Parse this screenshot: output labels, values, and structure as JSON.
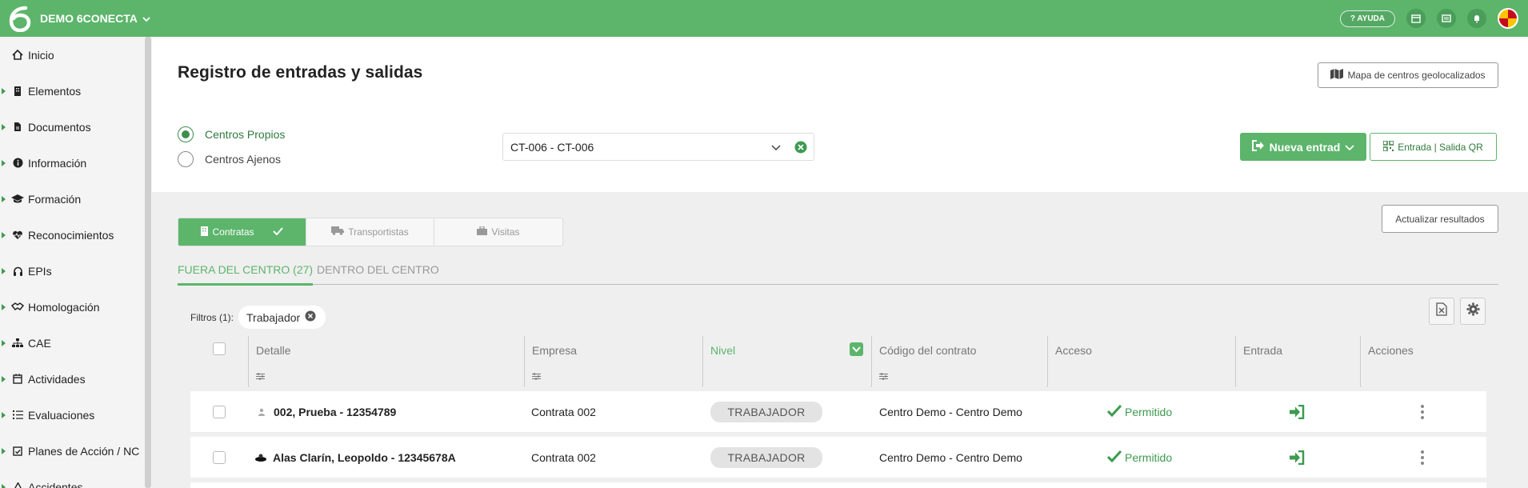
{
  "app": {
    "brand": "DEMO 6CONECTA",
    "help_label": "AYUDA"
  },
  "sidebar": {
    "items": [
      {
        "label": "Inicio",
        "icon": "home-icon",
        "caret": false
      },
      {
        "label": "Elementos",
        "icon": "building-icon",
        "caret": true
      },
      {
        "label": "Documentos",
        "icon": "document-icon",
        "caret": true
      },
      {
        "label": "Información",
        "icon": "info-icon",
        "caret": true
      },
      {
        "label": "Formación",
        "icon": "graduation-cap-icon",
        "caret": true
      },
      {
        "label": "Reconocimientos",
        "icon": "heartbeat-icon",
        "caret": true
      },
      {
        "label": "EPIs",
        "icon": "headphones-icon",
        "caret": true
      },
      {
        "label": "Homologación",
        "icon": "handshake-icon",
        "caret": true
      },
      {
        "label": "CAE",
        "icon": "sitemap-icon",
        "caret": true
      },
      {
        "label": "Actividades",
        "icon": "calendar-icon",
        "caret": true
      },
      {
        "label": "Evaluaciones",
        "icon": "list-icon",
        "caret": true
      },
      {
        "label": "Planes de Acción / NC",
        "icon": "calendar-check-icon",
        "caret": true
      },
      {
        "label": "Accidentes",
        "icon": "warning-icon",
        "caret": true
      }
    ]
  },
  "page": {
    "title": "Registro de entradas y salidas",
    "map_button": "Mapa de centros geolocalizados",
    "radio_own": "Centros Propios",
    "radio_external": "Centros Ajenos",
    "center_select_value": "CT-006 - CT-006",
    "new_entry_button": "Nueva entrad",
    "qr_button": "Entrada | Salida QR",
    "refresh_button": "Actualizar resultados"
  },
  "segments": {
    "contratas": "Contratas",
    "transportistas": "Transportistas",
    "visitas": "Visitas"
  },
  "tabs": {
    "outside": "FUERA DEL CENTRO (27)",
    "inside": "DENTRO DEL CENTRO"
  },
  "filters": {
    "label": "Filtros (1):",
    "chip": "Trabajador"
  },
  "table": {
    "columns": {
      "detalle": "Detalle",
      "empresa": "Empresa",
      "nivel": "Nivel",
      "codigo": "Código del contrato",
      "acceso": "Acceso",
      "entrada": "Entrada",
      "acciones": "Acciones"
    },
    "rows": [
      {
        "detalle": "002, Prueba - 12354789",
        "empresa": "Contrata 002",
        "nivel": "TRABAJADOR",
        "codigo": "Centro Demo - Centro Demo",
        "acceso": "Permitido"
      },
      {
        "detalle": "Alas Clarín, Leopoldo - 12345678A",
        "empresa": "Contrata 002",
        "nivel": "TRABAJADOR",
        "codigo": "Centro Demo - Centro Demo",
        "acceso": "Permitido"
      }
    ]
  },
  "colors": {
    "brand_green": "#5cb56b",
    "dark_green": "#2f7a3d"
  }
}
